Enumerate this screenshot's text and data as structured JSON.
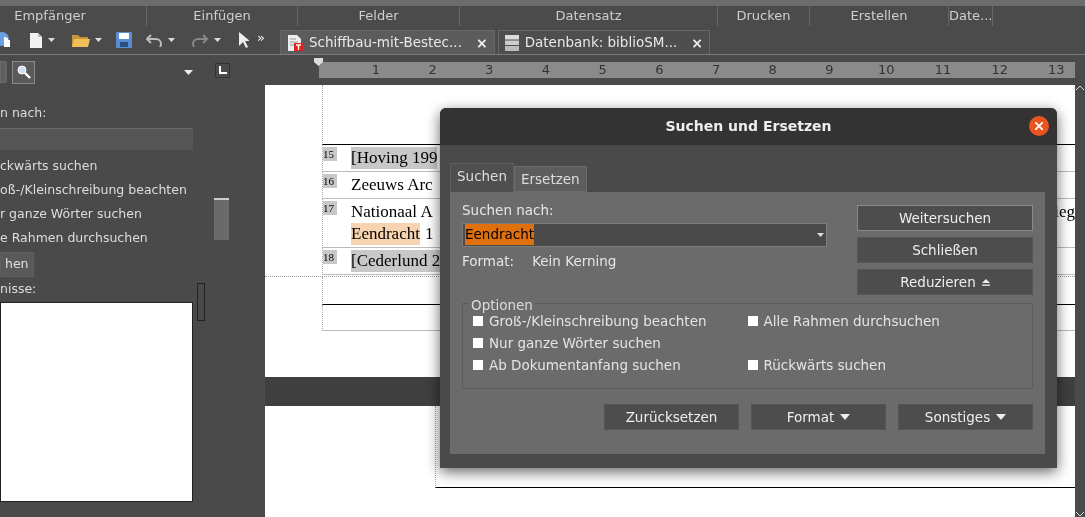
{
  "ribbon_groups": [
    "Empfänger",
    "Einfügen",
    "Felder",
    "Datensatz",
    "Drucken",
    "Erstellen",
    "Date..."
  ],
  "toolbar": {
    "overflow": "»"
  },
  "document_tabs": [
    {
      "title": "Schiffbau-mit-Bestec...",
      "kind": "text-document",
      "selected": true,
      "close": "×"
    },
    {
      "title": "Datenbank: biblioSM...",
      "kind": "database",
      "selected": false,
      "close": "×"
    }
  ],
  "sidebar": {
    "search_label": "n nach:",
    "options": [
      "ckwärts suchen",
      "oß-/Kleinschreibung beachten",
      "r ganze Wörter suchen",
      "e Rahmen durchsuchen"
    ],
    "button": "hen",
    "results_label": "nisse:"
  },
  "ruler": {
    "numbers": [
      "1",
      "2",
      "3",
      "4",
      "5",
      "6",
      "7",
      "8",
      "9",
      "10",
      "11",
      "12",
      "13"
    ]
  },
  "document": {
    "rows": [
      {
        "number": "15",
        "parts": [
          {
            "text": "[Hoving 199",
            "shaded": true,
            "highlighted": false
          }
        ]
      },
      {
        "number": "16",
        "parts": [
          {
            "text": "Zeeuws Arc",
            "shaded": false,
            "highlighted": false
          }
        ]
      },
      {
        "number": "17",
        "parts": [
          {
            "text": "Nationaal A",
            "shaded": false,
            "highlighted": false
          }
        ],
        "right_text": "ieg",
        "continuation": [
          {
            "text": "Eendracht",
            "shaded": false,
            "highlighted": true
          },
          {
            "text": "1",
            "shaded": false,
            "highlighted": false
          }
        ]
      },
      {
        "number": "18",
        "parts": [
          {
            "text": "[Cederlund 2",
            "shaded": true,
            "highlighted": false
          }
        ]
      }
    ]
  },
  "dialog": {
    "title": "Suchen und Ersetzen",
    "tabs": [
      {
        "label": "Suchen",
        "selected": true
      },
      {
        "label": "Ersetzen",
        "selected": false
      }
    ],
    "search_label": "Suchen nach:",
    "search_value": "Eendracht",
    "value_selected": true,
    "format_label": "Format:",
    "format_value": "Kein Kerning",
    "side_buttons": [
      {
        "label": "Weitersuchen",
        "default": true,
        "kind": "plain"
      },
      {
        "label": "Schließen",
        "default": false,
        "kind": "plain"
      },
      {
        "label": "Reduzieren",
        "default": false,
        "kind": "collapse"
      }
    ],
    "options_title": "Optionen",
    "option_rows": [
      [
        {
          "label": "Groß-/Kleinschreibung beachten",
          "checked": false
        },
        {
          "label": "Alle Rahmen durchsuchen",
          "checked": false
        }
      ],
      [
        {
          "label": "Nur ganze Wörter suchen",
          "checked": false
        }
      ],
      [
        {
          "label": "Ab Dokumentanfang suchen",
          "checked": false
        },
        {
          "label": "Rückwärts suchen",
          "checked": false
        }
      ]
    ],
    "bottom_buttons": [
      {
        "label": "Zurücksetzen",
        "default": false,
        "kind": "plain"
      },
      {
        "label": "Format",
        "default": false,
        "kind": "menu"
      },
      {
        "label": "Sonstiges",
        "default": false,
        "kind": "menu"
      }
    ]
  }
}
